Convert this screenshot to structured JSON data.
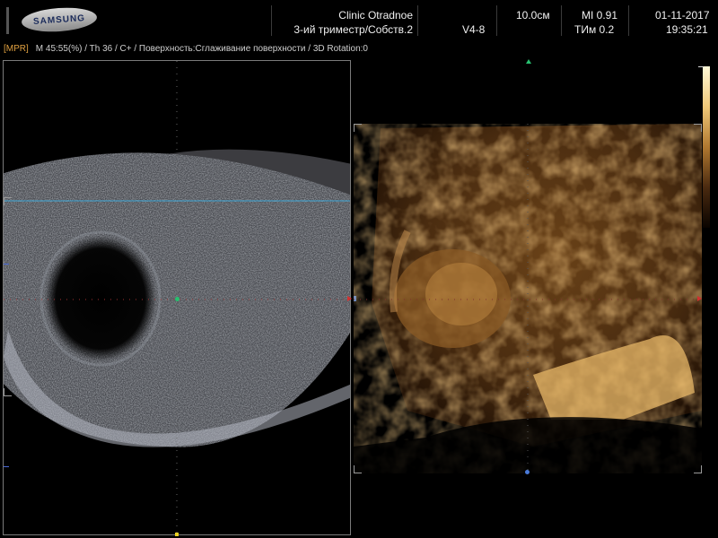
{
  "header": {
    "logo": "SAMSUNG",
    "clinic": "Clinic  Otradnoe",
    "preset": "3-ий триместр/Собств.2",
    "probe": "V4-8",
    "depth": "10.0cм",
    "mi": "MI  0.91",
    "tib": "TИм 0.2",
    "date": "01-11-2017",
    "time": "19:35:21"
  },
  "infoline": {
    "mode": "[MPR]",
    "params": "M 45:55(%) / Th 36 / C+ / Поверхность:Сглаживание поверхности / 3D Rotation:0"
  },
  "colors": {
    "accent": "#e0a040",
    "frame": "#7a7a7a",
    "scanline": "#3fa8d8"
  }
}
